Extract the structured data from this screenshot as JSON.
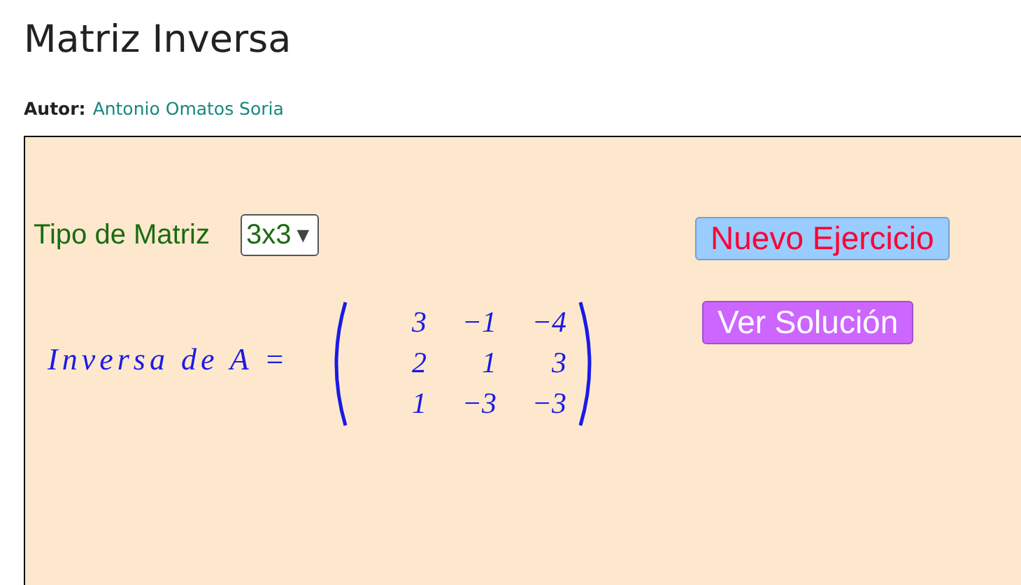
{
  "title": "Matriz Inversa",
  "author": {
    "label": "Autor:",
    "name": "Antonio Omatos Soria"
  },
  "applet": {
    "type_label": "Tipo de Matriz",
    "type_value": "3x3",
    "caret": "▼",
    "matrix_label": "Inversa de A =",
    "matrix": [
      [
        "3",
        "−1",
        "−4"
      ],
      [
        "2",
        "1",
        "3"
      ],
      [
        "1",
        "−3",
        "−3"
      ]
    ],
    "buttons": [
      {
        "label": "Nuevo Ejercicio",
        "kind": "new"
      },
      {
        "label": "Ver Solución",
        "kind": "solution"
      }
    ]
  }
}
